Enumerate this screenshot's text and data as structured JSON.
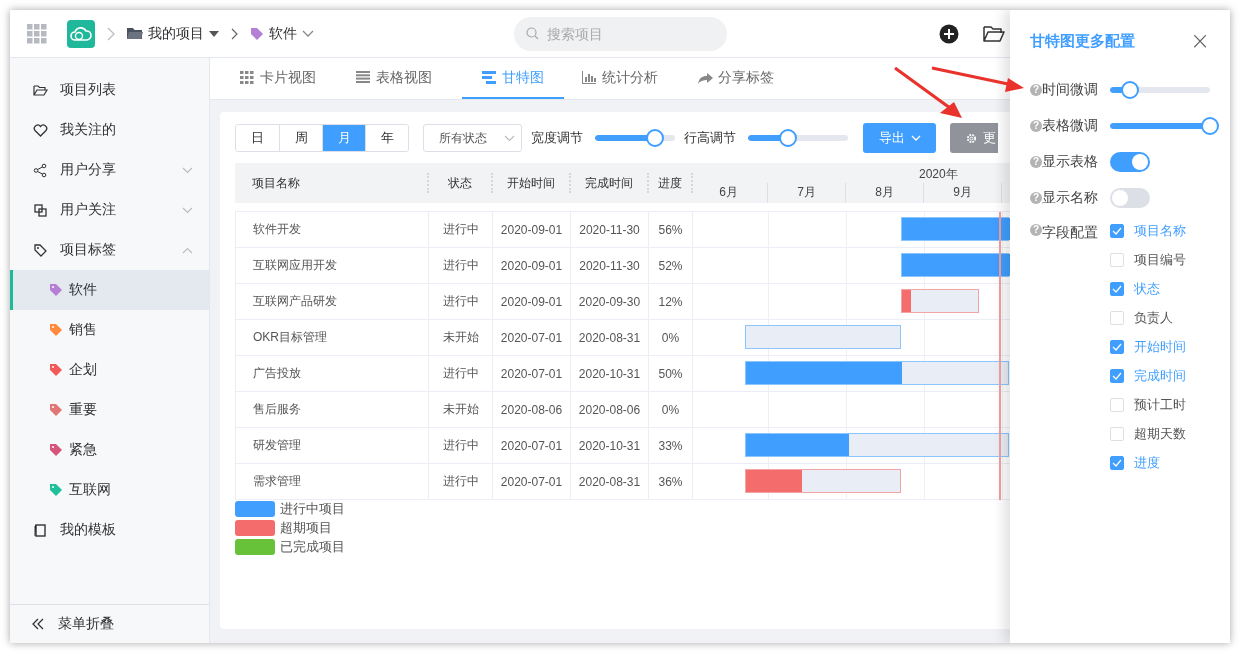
{
  "header": {
    "breadcrumb": [
      {
        "label": "我的项目",
        "dropdown": true
      },
      {
        "label": "软件",
        "dropdown": true,
        "color": "#b57fd6"
      }
    ],
    "search": {
      "placeholder": "搜索项目"
    }
  },
  "sidebar": {
    "items": [
      {
        "label": "项目列表",
        "selected": false
      },
      {
        "label": "我关注的",
        "selected": false
      },
      {
        "label": "用户分享",
        "selected": false,
        "expanded": false
      },
      {
        "label": "用户关注",
        "selected": false,
        "expanded": false
      },
      {
        "label": "项目标签",
        "selected": false,
        "expanded": true,
        "children": [
          {
            "label": "软件",
            "color": "#b57fd6",
            "selected": true
          },
          {
            "label": "销售",
            "color": "#ff8a3d",
            "selected": false
          },
          {
            "label": "企划",
            "color": "#f25a5a",
            "selected": false
          },
          {
            "label": "重要",
            "color": "#e07676",
            "selected": false
          },
          {
            "label": "紧急",
            "color": "#d6557a",
            "selected": false
          },
          {
            "label": "互联网",
            "color": "#1fbf9a",
            "selected": false
          }
        ]
      },
      {
        "label": "我的模板",
        "selected": false
      }
    ],
    "footer": "菜单折叠"
  },
  "tabs": [
    {
      "label": "卡片视图",
      "selected": false
    },
    {
      "label": "表格视图",
      "selected": false
    },
    {
      "label": "甘特图",
      "selected": true
    },
    {
      "label": "统计分析",
      "selected": false
    },
    {
      "label": "分享标签",
      "selected": false
    }
  ],
  "toolbar": {
    "scales": [
      {
        "label": "日",
        "selected": false
      },
      {
        "label": "周",
        "selected": false
      },
      {
        "label": "月",
        "selected": true
      },
      {
        "label": "年",
        "selected": false
      }
    ],
    "status_filter": "所有状态",
    "sliders": [
      {
        "label": "宽度调节",
        "level": 0.75
      },
      {
        "label": "行高调节",
        "level": 0.4
      }
    ],
    "export_button": "导出",
    "more_button": "更"
  },
  "table": {
    "columns": [
      "项目名称",
      "状态",
      "开始时间",
      "完成时间",
      "进度"
    ],
    "rows": [
      {
        "name": "软件开发",
        "status": "进行中",
        "start": "2020-09-01",
        "end": "2020-11-30",
        "progress": "56%",
        "overdue": false
      },
      {
        "name": "互联网应用开发",
        "status": "进行中",
        "start": "2020-09-01",
        "end": "2020-11-30",
        "progress": "52%",
        "overdue": false
      },
      {
        "name": "互联网产品研发",
        "status": "进行中",
        "start": "2020-09-01",
        "end": "2020-09-30",
        "progress": "12%",
        "overdue": true
      },
      {
        "name": "OKR目标管理",
        "status": "未开始",
        "start": "2020-07-01",
        "end": "2020-08-31",
        "progress": "0%",
        "overdue": false
      },
      {
        "name": "广告投放",
        "status": "进行中",
        "start": "2020-07-01",
        "end": "2020-10-31",
        "progress": "50%",
        "overdue": false
      },
      {
        "name": "售后服务",
        "status": "未开始",
        "start": "2020-08-06",
        "end": "2020-08-06",
        "progress": "0%"
      },
      {
        "name": "研发管理",
        "status": "进行中",
        "start": "2020-07-01",
        "end": "2020-10-31",
        "progress": "33%",
        "overdue": false
      },
      {
        "name": "需求管理",
        "status": "进行中",
        "start": "2020-07-01",
        "end": "2020-08-31",
        "progress": "36%",
        "overdue": true
      }
    ]
  },
  "timeline": {
    "year": "2020年",
    "months": [
      "6月",
      "7月",
      "8月",
      "9月"
    ]
  },
  "legend": [
    {
      "label": "进行中项目",
      "color": "#409eff"
    },
    {
      "label": "超期项目",
      "color": "#f56c6c"
    },
    {
      "label": "已完成项目",
      "color": "#67c23a"
    }
  ],
  "panel": {
    "title": "甘特图更多配置",
    "close": "×",
    "hint": "?",
    "settings": [
      {
        "kind": "slider",
        "label": "时间微调",
        "level": 0.2
      },
      {
        "kind": "slider",
        "label": "表格微调",
        "level": 1
      },
      {
        "kind": "toggle",
        "label": "显示表格",
        "on": true
      },
      {
        "kind": "toggle",
        "label": "显示名称",
        "on": false
      }
    ],
    "fields_label": "字段配置",
    "fields": [
      {
        "label": "项目名称",
        "checked": true
      },
      {
        "label": "项目编号",
        "checked": false
      },
      {
        "label": "状态",
        "checked": true
      },
      {
        "label": "负责人",
        "checked": false
      },
      {
        "label": "开始时间",
        "checked": true
      },
      {
        "label": "完成时间",
        "checked": true
      },
      {
        "label": "预计工时",
        "checked": false
      },
      {
        "label": "超期天数",
        "checked": false
      },
      {
        "label": "进度",
        "checked": true
      }
    ]
  }
}
